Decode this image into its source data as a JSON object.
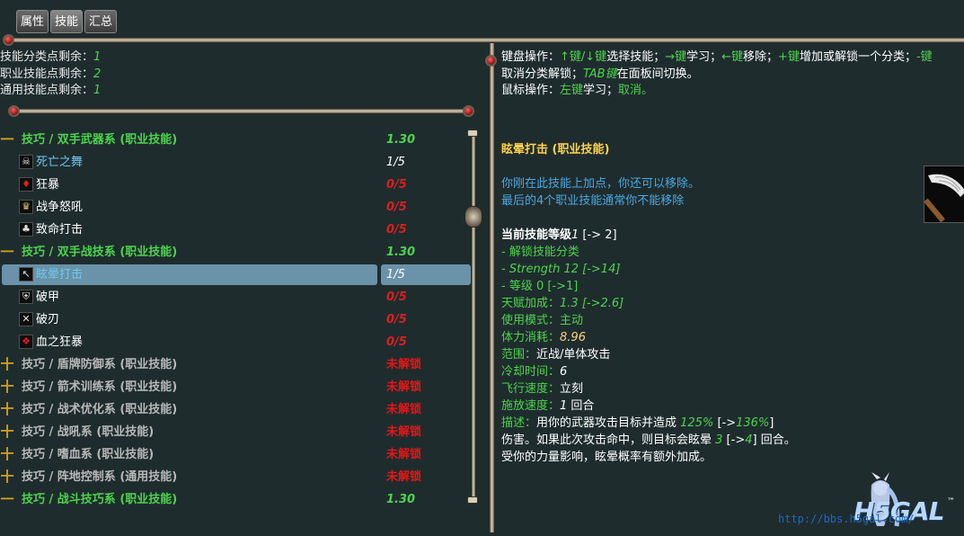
{
  "tabs": [
    {
      "label": "属性"
    },
    {
      "label": "技能"
    },
    {
      "label": "汇总"
    }
  ],
  "points": {
    "category_label": "技能分类点剩余：",
    "category_value": "1",
    "class_label": "职业技能点剩余：",
    "class_value": "2",
    "general_label": "通用技能点剩余：",
    "general_value": "1"
  },
  "tree": {
    "cat1": {
      "prefix": "一",
      "label": "技巧 / 双手武器系 (职业技能)",
      "value": "1.30"
    },
    "cat1_skills": [
      {
        "icon": "skull-icon",
        "glyph": "☠",
        "name": "死亡之舞",
        "value": "1/5"
      },
      {
        "icon": "blood-drop-icon",
        "glyph": "♦",
        "name": "狂暴",
        "value": "0/5"
      },
      {
        "icon": "war-cry-icon",
        "glyph": "♛",
        "name": "战争怒吼",
        "value": "0/5"
      },
      {
        "icon": "critical-strike-icon",
        "glyph": "♣",
        "name": "致命打击",
        "value": "0/5"
      }
    ],
    "cat2": {
      "prefix": "一",
      "label": "技巧 / 双手战技系 (职业技能)",
      "value": "1.30"
    },
    "cat2_skills": [
      {
        "icon": "stun-strike-icon",
        "glyph": "↖",
        "name": "眩晕打击",
        "value": "1/5"
      },
      {
        "icon": "armor-break-icon",
        "glyph": "⛨",
        "name": "破甲",
        "value": "0/5"
      },
      {
        "icon": "blade-break-icon",
        "glyph": "✕",
        "name": "破刃",
        "value": "0/5"
      },
      {
        "icon": "blood-rage-icon",
        "glyph": "❖",
        "name": "血之狂暴",
        "value": "0/5"
      }
    ],
    "locked": [
      {
        "prefix": "十",
        "label": "技巧 / 盾牌防御系 (职业技能)",
        "value": "未解锁"
      },
      {
        "prefix": "十",
        "label": "技巧 / 箭术训练系 (职业技能)",
        "value": "未解锁"
      },
      {
        "prefix": "十",
        "label": "技巧 / 战术优化系 (职业技能)",
        "value": "未解锁"
      },
      {
        "prefix": "十",
        "label": "技巧 / 战吼系 (职业技能)",
        "value": "未解锁"
      },
      {
        "prefix": "十",
        "label": "技巧 / 嗜血系 (职业技能)",
        "value": "未解锁"
      },
      {
        "prefix": "十",
        "label": "技巧 / 阵地控制系 (通用技能)",
        "value": "未解锁"
      }
    ],
    "last": {
      "prefix": "一",
      "label": "技巧 / 战斗技巧系 (职业技能)",
      "value": "1.30"
    }
  },
  "help": {
    "kbd_prefix": "键盘操作：",
    "kbd_updown": "↑键/↓键",
    "kbd_select": "选择技能；",
    "kbd_right": "→键",
    "kbd_learn": "学习；",
    "kbd_left": "←键",
    "kbd_remove": "移除；",
    "kbd_plus": "+键",
    "kbd_plus_desc": "增加或解锁一个分类；",
    "kbd_minus": "-键",
    "kbd_minus_desc": "取消分类解锁；",
    "kbd_tab": "TAB键",
    "kbd_tab_desc": "在面板间切换。",
    "mouse_prefix": "鼠标操作：",
    "mouse_left": "左键",
    "mouse_learn": "学习；",
    "mouse_cancel": "取消。"
  },
  "detail": {
    "title": "眩晕打击 (职业技能)",
    "note1": "你刚在此技能上加点，你还可以移除。",
    "note2": "最后的4个职业技能通常你不能移除",
    "level_label": "当前技能等级",
    "level_value": "1",
    "level_next": " [-> 2]",
    "req1": "- 解锁技能分类",
    "req2": "- Strength 12 [->14]",
    "req3": "- 等级 0 [->1]",
    "talent_label": "天赋加成：",
    "talent_value": "1.3 [->2.6]",
    "mode_label": "使用模式：",
    "mode_value": "主动",
    "cost_label": "体力消耗：",
    "cost_value": "8.96",
    "range_label": "范围：",
    "range_value": "近战/单体攻击",
    "cooldown_label": "冷却时间：",
    "cooldown_value": "6",
    "speed_label": "飞行速度：",
    "speed_value": "立刻",
    "cast_label": "施放速度：",
    "cast_value": "1",
    "cast_unit": " 回合",
    "desc_label": "描述：",
    "desc_a": "用你的武器攻击目标并造成 ",
    "desc_pct": "125%",
    "desc_b": " [->",
    "desc_pct2": "136%",
    "desc_c": "]",
    "desc_line2a": "伤害。如果此次攻击命中，则目标会眩晕 ",
    "desc_turns": "3",
    "desc_line2b": " [->",
    "desc_turns2": "4",
    "desc_line2c": "] 回合。",
    "desc_line3": "受你的力量影响，眩晕概率有额外加成。"
  },
  "watermark": {
    "url": "http://bbs.h5gal.com/",
    "logo": "H5GAL"
  }
}
